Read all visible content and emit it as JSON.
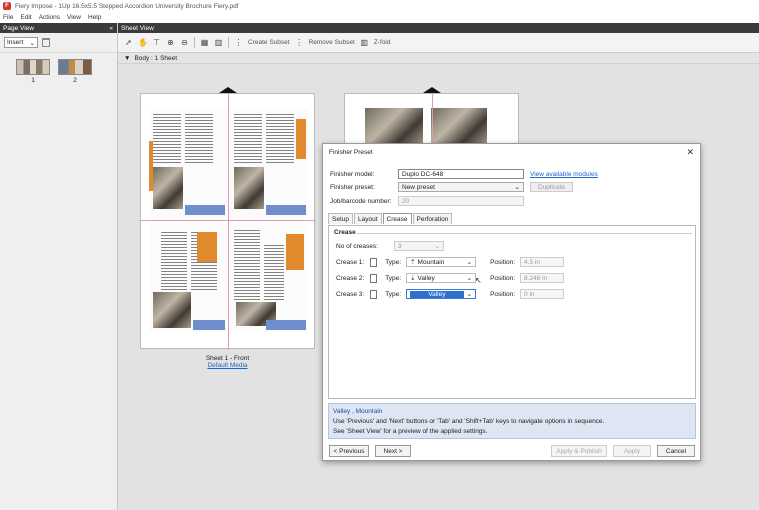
{
  "window": {
    "title": "Fiery Impose - 1Up 16.5x5.5 Stepped Accordion University Brochure Fiery.pdf",
    "app_icon_letter": "F"
  },
  "menu": [
    "File",
    "Edit",
    "Actions",
    "View",
    "Help"
  ],
  "page_view": {
    "header": "Page View",
    "collapse_glyph": "«",
    "insert_label": "Insert",
    "thumbnails": [
      {
        "label": "1"
      },
      {
        "label": "2"
      }
    ]
  },
  "sheet_view": {
    "header": "Sheet View",
    "toolbar": {
      "create_subset": "Create Subset",
      "remove_subset": "Remove Subset",
      "z_fold": "Z-fold"
    },
    "body_label": "Body : 1 Sheet",
    "sheet_caption": "Sheet 1 - Front",
    "sheet_media": "Default Media"
  },
  "dialog": {
    "title": "Finisher Preset",
    "close_glyph": "✕",
    "finisher_model_label": "Finisher model:",
    "finisher_model_value": "Duplo DC-648",
    "view_modules_link": "View available modules",
    "finisher_preset_label": "Finisher preset:",
    "finisher_preset_value": "New preset",
    "duplicate_label": "Duplicate",
    "job_barcode_label": "Job/barcode number:",
    "job_barcode_value": "20",
    "tabs": [
      "Setup",
      "Layout",
      "Crease",
      "Perforation"
    ],
    "active_tab": "Crease",
    "crease": {
      "section_title": "Crease",
      "num_creases_label": "No of creases:",
      "num_creases_value": "3",
      "rows": [
        {
          "label": "Crease 1:",
          "type_label": "Type:",
          "type_value": "Mountain",
          "type_icon": "mountain-arrow-icon",
          "position_label": "Position:",
          "position_value": "4.5 in"
        },
        {
          "label": "Crease 2:",
          "type_label": "Type:",
          "type_value": "Valley",
          "type_icon": "valley-arrow-icon",
          "position_label": "Position:",
          "position_value": "8.248 in"
        },
        {
          "label": "Crease 3:",
          "type_label": "Type:",
          "type_value": "Valley",
          "type_icon": "",
          "position_label": "Position:",
          "position_value": "0 in"
        }
      ]
    },
    "info": {
      "line1": "Valley , Mountain",
      "line2": "Use 'Previous' and 'Next' buttons or 'Tab' and 'Shift+Tab' keys to navigate options in sequence.",
      "line3": "See 'Sheet View' for a preview of the applied settings."
    },
    "buttons": {
      "previous": "< Previous",
      "next": "Next >",
      "apply_publish": "Apply & Publish",
      "apply": "Apply",
      "cancel": "Cancel"
    }
  },
  "colors": {
    "accent_blue": "#2f6fce",
    "brochure_orange": "#e08a2d",
    "brochure_blue": "#6f8ecb",
    "header_dark": "#3b3b3b"
  }
}
